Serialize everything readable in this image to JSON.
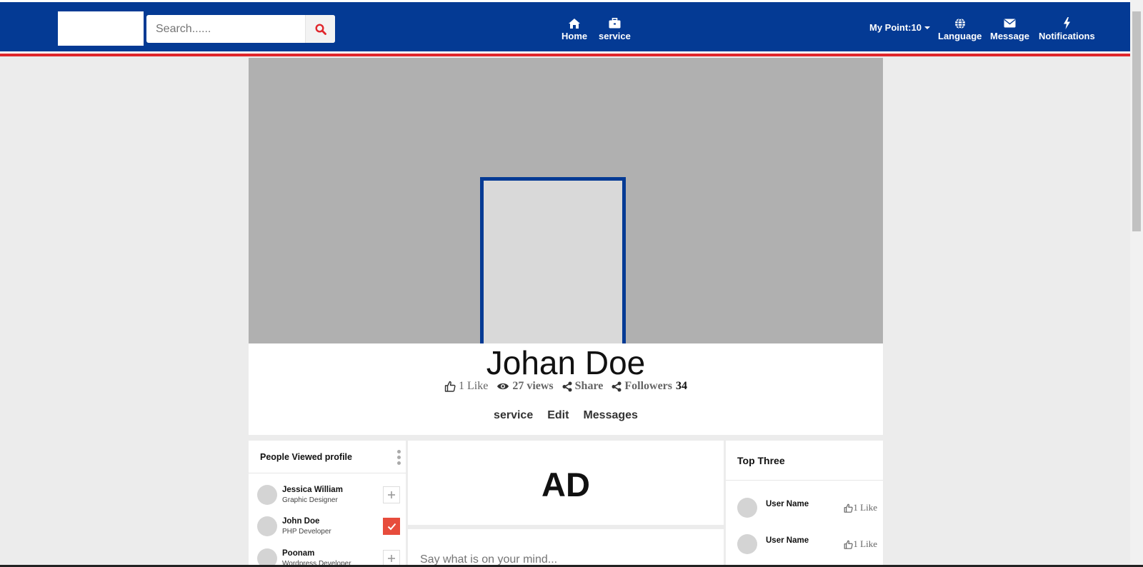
{
  "header": {
    "search_placeholder": "Search......",
    "nav": [
      {
        "label": "Home",
        "icon": "home-icon"
      },
      {
        "label": "service",
        "icon": "briefcase-icon"
      }
    ],
    "my_point": "My Point:10",
    "right_nav": [
      {
        "label": "Language",
        "icon": "globe-icon"
      },
      {
        "label": "Message",
        "icon": "envelope-icon"
      },
      {
        "label": "Notifications",
        "icon": "bolt-icon"
      }
    ],
    "colors": {
      "primary": "#043a94",
      "accent": "#e0262c"
    }
  },
  "profile": {
    "name": "Johan Doe",
    "likes": "1 Like",
    "views": "27 views",
    "share": "Share",
    "followers_label": "Followers",
    "followers_count": "34",
    "tabs": [
      "service",
      "Edit",
      "Messages"
    ]
  },
  "people_viewed": {
    "title": "People Viewed profile",
    "people": [
      {
        "name": "Jessica William",
        "role": "Graphic Designer",
        "action": "add"
      },
      {
        "name": "John Doe",
        "role": "PHP Developer",
        "action": "added"
      },
      {
        "name": "Poonam",
        "role": "Wordpress Developer",
        "action": "add"
      }
    ]
  },
  "ad": {
    "text": "AD"
  },
  "post": {
    "placeholder": "Say what is on your mind..."
  },
  "top_three": {
    "title": "Top Three",
    "users": [
      {
        "name": "User Name",
        "likes": "1 Like"
      },
      {
        "name": "User Name",
        "likes": "1 Like"
      }
    ]
  }
}
